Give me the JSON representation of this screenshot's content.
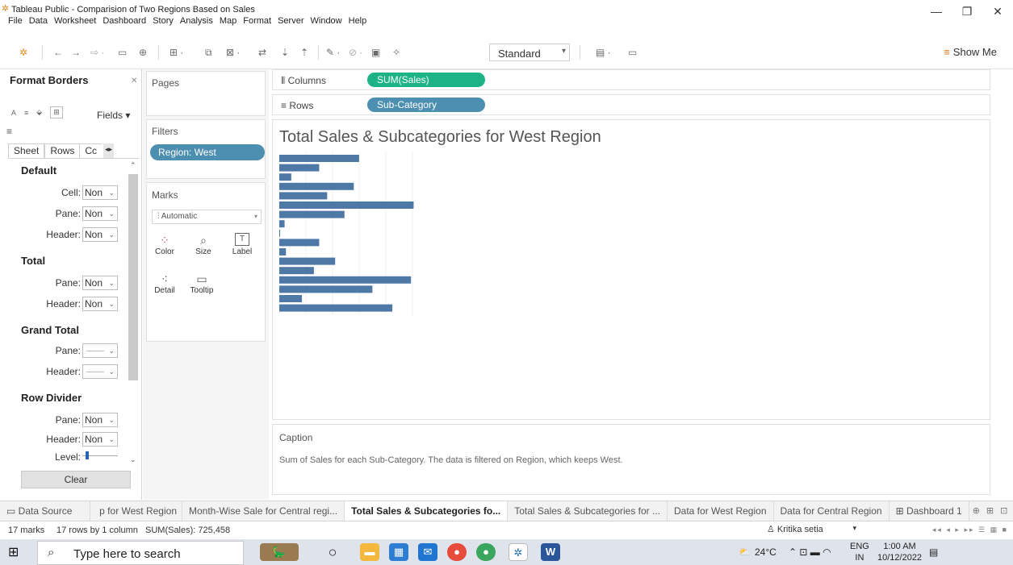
{
  "window": {
    "title": "Tableau Public - Comparision of Two Regions Based on Sales",
    "controls": [
      "—",
      "❐",
      "✕"
    ]
  },
  "menu": [
    "File",
    "Data",
    "Worksheet",
    "Dashboard",
    "Story",
    "Analysis",
    "Map",
    "Format",
    "Server",
    "Window",
    "Help"
  ],
  "toolbar": {
    "standard_label": "Standard",
    "show_me_label": "Show Me"
  },
  "format_pane": {
    "title": "Format Borders",
    "fields_label": "Fields ▾",
    "tabs": [
      "Sheet",
      "Rows",
      "Cc"
    ],
    "sections": {
      "default": "Default",
      "total": "Total",
      "grand_total": "Grand Total",
      "row_divider": "Row Divider"
    },
    "labels": {
      "cell": "Cell:",
      "pane": "Pane:",
      "header": "Header:",
      "level": "Level:"
    },
    "none_value": "Non",
    "clear_label": "Clear"
  },
  "pages_card": {
    "title": "Pages"
  },
  "filters_card": {
    "title": "Filters",
    "pill": "Region: West"
  },
  "marks_card": {
    "title": "Marks",
    "type": "Automatic",
    "buttons": [
      "Color",
      "Size",
      "Label",
      "Detail",
      "Tooltip"
    ]
  },
  "shelves": {
    "columns_label": "Columns",
    "columns_pill": "SUM(Sales)",
    "rows_label": "Rows",
    "rows_pill": "Sub-Category"
  },
  "view": {
    "title": "Total Sales & Subcategories for West Region"
  },
  "chart_data": {
    "type": "bar",
    "orientation": "horizontal",
    "categories": [],
    "values": [
      60,
      30,
      9,
      56,
      36,
      101,
      49,
      4,
      0.6,
      30,
      5,
      42,
      26,
      99,
      70,
      17,
      85
    ],
    "xlim": [
      0,
      108
    ],
    "grid": true,
    "color": "#4e79a7"
  },
  "caption": {
    "title": "Caption",
    "text": "Sum of Sales for each Sub-Category. The data is filtered on Region, which keeps West."
  },
  "sheet_tabs": [
    "Data Source",
    "p for West Region",
    "Month-Wise Sale for Central regi...",
    "Total Sales & Subcategories fo...",
    "Total Sales & Subcategories for ...",
    "Data for West Region",
    "Data for Central Region",
    "Dashboard 1"
  ],
  "status": {
    "marks": "17 marks",
    "rows_cols": "17 rows by 1 column",
    "sum": "SUM(Sales): 725,458",
    "user": "Kritika setia"
  },
  "taskbar": {
    "search_placeholder": "Type here to search",
    "temperature": "24°C",
    "lang_top": "ENG",
    "lang_bottom": "IN",
    "time": "1:00 AM",
    "date": "10/12/2022"
  }
}
